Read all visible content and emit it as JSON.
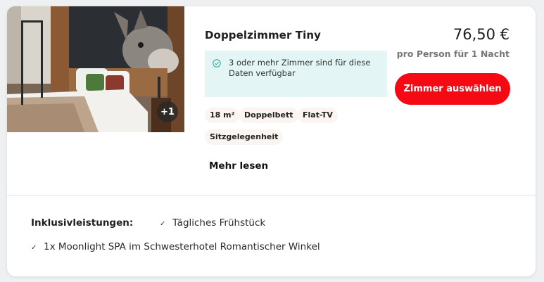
{
  "room": {
    "title": "Doppelzimmer Tiny",
    "image_more_count": "+1",
    "availability_text": "3 oder mehr Zimmer sind für diese Daten verfügbar",
    "features": [
      "18 m²",
      "Doppelbett",
      "Flat-TV",
      "Sitzgelegenheit"
    ],
    "more_link": "Mehr lesen"
  },
  "pricing": {
    "price": "76,50 €",
    "note": "pro Person für 1 Nacht",
    "select_label": "Zimmer auswählen"
  },
  "inclusions": {
    "label": "Inklusivleistungen:",
    "items": [
      "Tägliches Frühstück",
      "1x Moonlight SPA im Schwesterhotel Romantischer Winkel"
    ]
  },
  "colors": {
    "accent": "#f50a14",
    "availability_bg": "#e3f5f5",
    "chip_bg": "#faf5f0"
  }
}
